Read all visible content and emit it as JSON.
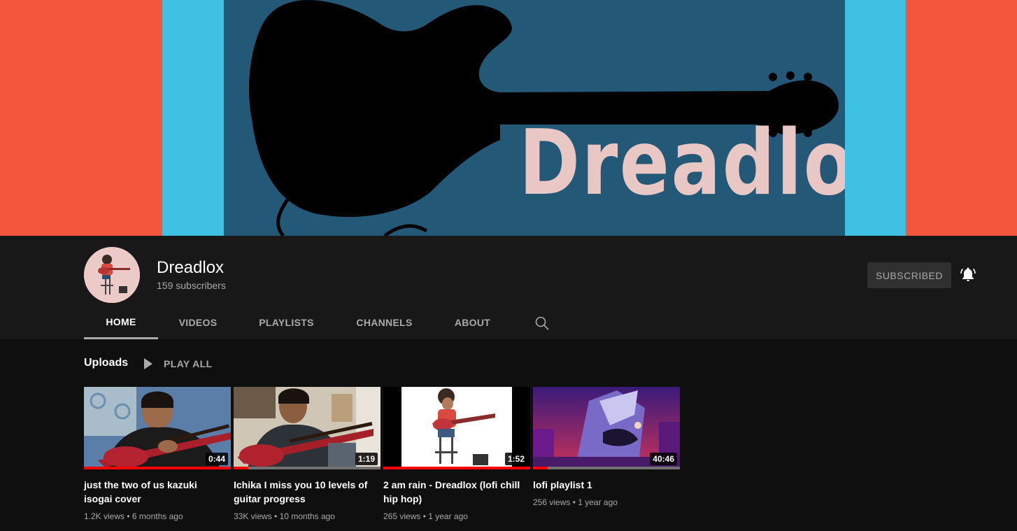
{
  "banner": {
    "title": "Dreadlox"
  },
  "channel": {
    "name": "Dreadlox",
    "subscribers": "159 subscribers",
    "subscribe_label": "SUBSCRIBED"
  },
  "tabs": [
    {
      "label": "HOME",
      "active": true
    },
    {
      "label": "VIDEOS",
      "active": false
    },
    {
      "label": "PLAYLISTS",
      "active": false
    },
    {
      "label": "CHANNELS",
      "active": false
    },
    {
      "label": "ABOUT",
      "active": false
    }
  ],
  "uploads": {
    "title": "Uploads",
    "play_all": "PLAY ALL",
    "videos": [
      {
        "title": "just the two of us kazuki isogai cover",
        "duration": "0:44",
        "views": "1.2K views",
        "age": "6 months ago",
        "watched": 1.0
      },
      {
        "title": "Ichika I miss you 10 levels of guitar progress",
        "duration": "1:19",
        "views": "33K views",
        "age": "10 months ago",
        "watched": 0.1
      },
      {
        "title": "2 am rain - Dreadlox (lofi chill hip hop)",
        "duration": "1:52",
        "views": "265 views",
        "age": "1 year ago",
        "watched": 1.0
      },
      {
        "title": "lofi playlist 1",
        "duration": "40:46",
        "views": "256 views",
        "age": "1 year ago",
        "watched": 0.1
      }
    ]
  },
  "colors": {
    "accent": "#ff0000",
    "banner_red": "#f4553d",
    "banner_cyan": "#3fc1e3",
    "banner_blue": "#245877",
    "banner_text": "#e9c7c5"
  }
}
